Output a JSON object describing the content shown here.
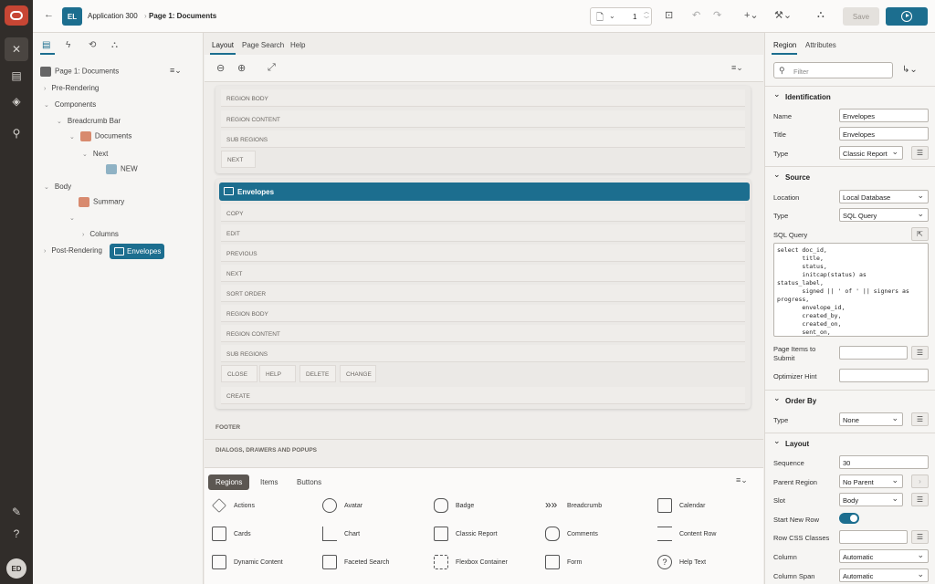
{
  "header": {
    "app_badge": "EL",
    "app_name": "Application 300",
    "page_name": "Page 1: Documents",
    "page_number": "1",
    "save_label": "Save"
  },
  "user": {
    "initials": "ED"
  },
  "tree": {
    "root": "Page 1: Documents",
    "rows": [
      "Pre-Rendering",
      "Components",
      "Breadcrumb Bar",
      "Documents",
      "Next",
      "NEW",
      "Body",
      "Summary",
      "Envelopes",
      "Columns",
      "Post-Rendering"
    ]
  },
  "center": {
    "tabs": [
      "Layout",
      "Page Search",
      "Help"
    ],
    "upper_slots": [
      "REGION BODY",
      "REGION CONTENT",
      "SUB REGIONS",
      "NEXT"
    ],
    "envelopes_title": "Envelopes",
    "env_slots": [
      "COPY",
      "EDIT",
      "PREVIOUS",
      "NEXT",
      "SORT ORDER",
      "REGION BODY",
      "REGION CONTENT",
      "SUB REGIONS"
    ],
    "env_chips": [
      "CLOSE",
      "HELP",
      "DELETE",
      "CHANGE"
    ],
    "create_slot": "CREATE",
    "footer": "FOOTER",
    "dialogs": "DIALOGS, DRAWERS AND POPUPS"
  },
  "gallery": {
    "tabs": [
      "Regions",
      "Items",
      "Buttons"
    ],
    "items": [
      "Actions",
      "Avatar",
      "Badge",
      "Breadcrumb",
      "Calendar",
      "Cards",
      "Chart",
      "Classic Report",
      "Comments",
      "Content Row",
      "Dynamic Content",
      "Faceted Search",
      "Flexbox Container",
      "Form",
      "Help Text"
    ]
  },
  "props": {
    "tabs": [
      "Region",
      "Attributes"
    ],
    "filter_placeholder": "Filter",
    "sec_identification": "Identification",
    "name_label": "Name",
    "name_value": "Envelopes",
    "title_label": "Title",
    "title_value": "Envelopes",
    "type_label": "Type",
    "type_value": "Classic Report",
    "sec_source": "Source",
    "location_label": "Location",
    "location_value": "Local Database",
    "src_type_label": "Type",
    "src_type_value": "SQL Query",
    "sql_label": "SQL Query",
    "sql_text": "select doc_id,\n       title,\n       status,\n       initcap(status) as\nstatus_label,\n       signed || ' of ' || signers as\nprogress,\n       envelope_id,\n       created_by,\n       created_on,\n       sent_on,",
    "items_submit_label": "Page Items to\nSubmit",
    "opt_hint_label": "Optimizer Hint",
    "sec_order": "Order By",
    "order_type_label": "Type",
    "order_type_value": "None",
    "sec_layout": "Layout",
    "sequence_label": "Sequence",
    "sequence_value": "30",
    "parent_label": "Parent Region",
    "parent_value": "No Parent",
    "slot_label": "Slot",
    "slot_value": "Body",
    "new_row_label": "Start New Row",
    "row_css_label": "Row CSS Classes",
    "column_label": "Column",
    "column_value": "Automatic",
    "span_label": "Column Span",
    "span_value": "Automatic"
  }
}
